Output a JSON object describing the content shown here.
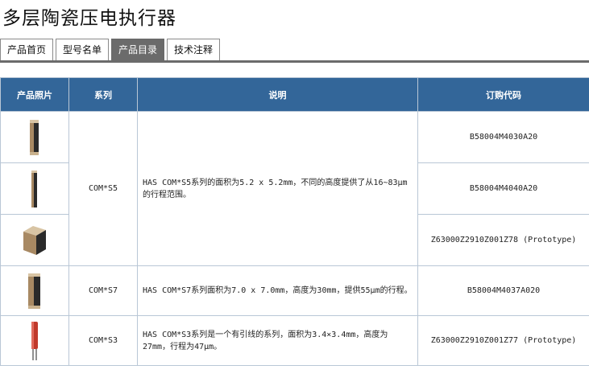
{
  "page": {
    "title": "多层陶瓷压电执行器"
  },
  "tabs": [
    {
      "label": "产品首页",
      "active": false
    },
    {
      "label": "型号名单",
      "active": false
    },
    {
      "label": "产品目录",
      "active": true
    },
    {
      "label": "技术注释",
      "active": false
    }
  ],
  "table": {
    "headers": {
      "photo": "产品照片",
      "series": "系列",
      "description": "说明",
      "order_code": "订购代码"
    },
    "groups": [
      {
        "series": "COM*S5",
        "description": "HAS COM*S5系列的面积为5.2 x 5.2mm，不同的高度提供了从16~83μm的行程范围。",
        "items": [
          {
            "photo": "tall-stack-photo",
            "order_code": "B58004M4030A20"
          },
          {
            "photo": "slim-stack-photo",
            "order_code": "B58004M4040A20"
          },
          {
            "photo": "cube-stack-photo",
            "order_code": "Z63000Z2910Z001Z78 (Prototype)"
          }
        ]
      },
      {
        "series": "COM*S7",
        "description": "HAS COM*S7系列面积为7.0 x 7.0mm，高度为30mm，提供55μm的行程。",
        "items": [
          {
            "photo": "wide-stack-photo",
            "order_code": "B58004M4037A020"
          }
        ]
      },
      {
        "series": "COM*S3",
        "description": "HAS COM*S3系列是一个有引线的系列，面积为3.4×3.4mm，高度为27mm，行程为47μm。",
        "items": [
          {
            "photo": "red-leaded-stack-photo",
            "order_code": "Z63000Z2910Z001Z77 (Prototype)"
          }
        ]
      }
    ]
  },
  "colors": {
    "header_bg": "#336699",
    "active_tab": "#6b6b6b",
    "border": "#b9c7d6"
  }
}
